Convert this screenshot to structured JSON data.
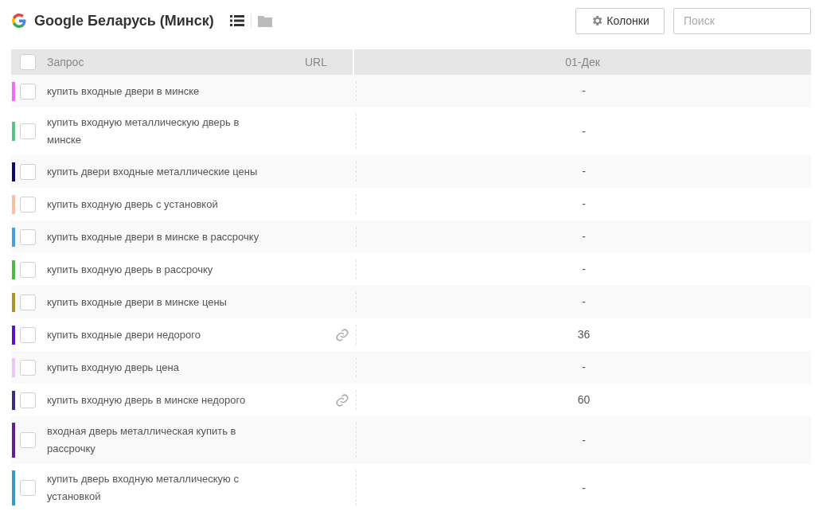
{
  "header": {
    "title": "Google Беларусь (Минск)",
    "columns_button": "Колонки",
    "search": {
      "placeholder": "Поиск"
    }
  },
  "table": {
    "columns": [
      "Запрос",
      "URL",
      "01-Дек"
    ],
    "select_all": {
      "checked": false
    },
    "rows": [
      {
        "query": "купить входные двери в минске",
        "color": "#f06cf0",
        "checked": false,
        "has_url": false,
        "value": "-"
      },
      {
        "query": "купить входную металлическую дверь в минске",
        "color": "#5ac48a",
        "checked": false,
        "has_url": false,
        "value": "-"
      },
      {
        "query": "купить двери входные металлические цены",
        "color": "#0c0c6a",
        "checked": false,
        "has_url": false,
        "value": "-"
      },
      {
        "query": "купить входную дверь с установкой",
        "color": "#f5c1a4",
        "checked": false,
        "has_url": false,
        "value": "-"
      },
      {
        "query": "купить входные двери в минске в рассрочку",
        "color": "#4a9ee0",
        "checked": false,
        "has_url": false,
        "value": "-"
      },
      {
        "query": "купить входную дверь в рассрочку",
        "color": "#4cb848",
        "checked": false,
        "has_url": false,
        "value": "-"
      },
      {
        "query": "купить входные двери в минске цены",
        "color": "#a8962e",
        "checked": false,
        "has_url": false,
        "value": "-"
      },
      {
        "query": "купить входные двери недорого",
        "color": "#5a14c8",
        "checked": false,
        "has_url": true,
        "value": "36"
      },
      {
        "query": "купить входную дверь цена",
        "color": "#eac8f4",
        "checked": false,
        "has_url": false,
        "value": "-"
      },
      {
        "query": "купить входную дверь в минске недорого",
        "color": "#3c2c7c",
        "checked": false,
        "has_url": true,
        "value": "60"
      },
      {
        "query": "входная дверь металлическая купить в рассрочку",
        "color": "#5c2290",
        "checked": false,
        "has_url": false,
        "value": "-"
      },
      {
        "query": "купить дверь входную металлическую с установкой",
        "color": "#3a9ac0",
        "checked": false,
        "has_url": false,
        "value": "-"
      }
    ]
  }
}
